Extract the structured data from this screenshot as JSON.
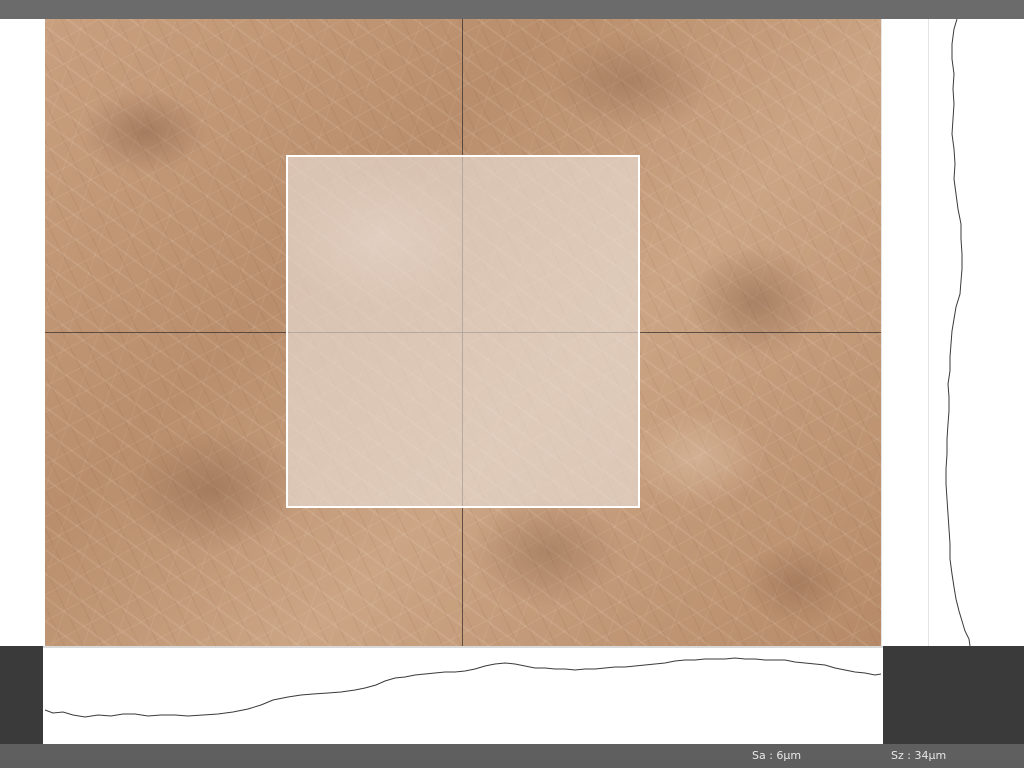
{
  "status_bar": {
    "sa": "Sa : 6µm",
    "sz": "Sz : 34µm"
  },
  "colors": {
    "top_bar": "#6b6b6b",
    "status_bar": "#5f5f5f",
    "panel_dark": "#3a3a3a",
    "roi_border": "#ffffff",
    "profile_line": "#3a3a3a",
    "crosshair": "#3c322d"
  },
  "icons": []
}
